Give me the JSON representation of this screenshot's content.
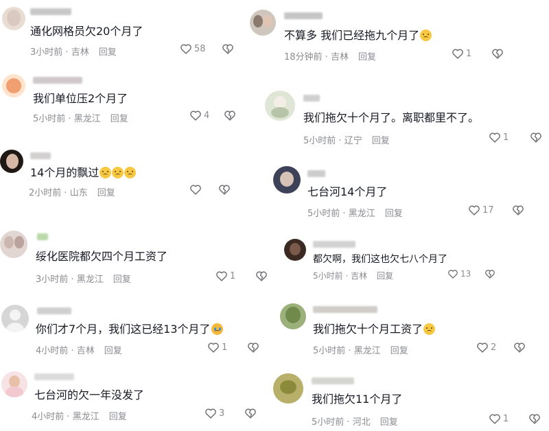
{
  "icons": {
    "like": "heart-outline-icon",
    "dislike": "broken-heart-icon"
  },
  "reply_label": "回复",
  "left": [
    {
      "text": "通化网格员欠20个月了",
      "emoji": [],
      "time": "3小时前",
      "loc": "吉林",
      "likes": "58",
      "avatar_color": "#d9c9c0"
    },
    {
      "text": "我们单位压2个月了",
      "emoji": [],
      "time": "5小时前",
      "loc": "黑龙江",
      "likes": "4",
      "avatar_color": "#f0a070"
    },
    {
      "text": "14个月的飘过",
      "emoji": [
        "sad",
        "sad",
        "sad"
      ],
      "time": "2小时前",
      "loc": "山东",
      "likes": "",
      "avatar_color": "#3a2a26"
    },
    {
      "text": "绥化医院都欠四个月工资了",
      "emoji": [],
      "time": "3小时前",
      "loc": "黑龙江",
      "likes": "1",
      "avatar_color": "#cbb6b0"
    },
    {
      "text": "你们才7个月，我们这已经13个月了",
      "emoji": [
        "cry"
      ],
      "time": "4小时前",
      "loc": "吉林",
      "likes": "1",
      "avatar_color": "#d6d6d6"
    },
    {
      "text": "七台河的欠一年没发了",
      "emoji": [],
      "time": "4小时前",
      "loc": "黑龙江",
      "likes": "3",
      "avatar_color": "#f2c9cf"
    }
  ],
  "right": [
    {
      "text": "不算多 我们已经拖九个月了",
      "emoji": [
        "sad"
      ],
      "time": "18分钟前",
      "loc": "吉林",
      "likes": "1",
      "avatar_color": "#8a7a6e"
    },
    {
      "text": "我们拖欠十个月了。离职都里不了。",
      "emoji": [],
      "time": "5小时前",
      "loc": "辽宁",
      "likes": "1",
      "avatar_color": "#b8c4a8"
    },
    {
      "text": "七台河14个月了",
      "emoji": [],
      "time": "5小时前",
      "loc": "黑龙江",
      "likes": "17",
      "avatar_color": "#6b6f88"
    },
    {
      "text": "都欠啊，我们这也欠七八个月了",
      "emoji": [],
      "time": "5小时前",
      "loc": "吉林",
      "likes": "13",
      "avatar_color": "#7a5a4a"
    },
    {
      "text": "我们拖欠十个月工资了",
      "emoji": [
        "sad"
      ],
      "time": "5小时前",
      "loc": "黑龙江",
      "likes": "2",
      "avatar_color": "#6f8a4a"
    },
    {
      "text": "我们拖欠11个月了",
      "emoji": [],
      "time": "5小时前",
      "loc": "河北",
      "likes": "1",
      "avatar_color": "#8a8a3a"
    }
  ]
}
